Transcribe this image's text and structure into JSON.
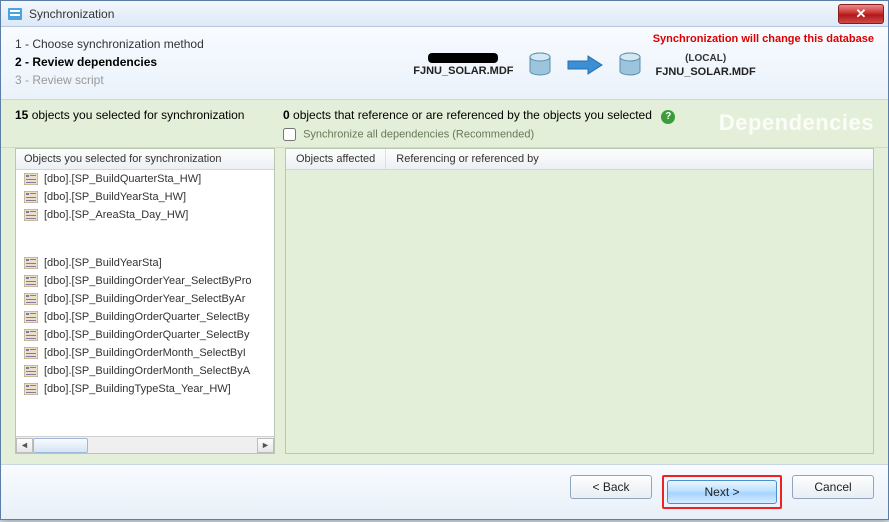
{
  "window": {
    "title": "Synchronization"
  },
  "titlebar": {
    "close_glyph": "✕"
  },
  "steps": {
    "s1": "1 - Choose synchronization method",
    "s2": "2 - Review dependencies",
    "s3": "3 - Review script"
  },
  "header_warning": "Synchronization will change this database",
  "source_db": "FJNU_SOLAR.MDF",
  "target_db_local": "(LOCAL)",
  "target_db": "FJNU_SOLAR.MDF",
  "counts": {
    "left_num": "15",
    "left_text": " objects you selected for synchronization",
    "right_num": "0",
    "right_text": " objects that reference or are referenced by the objects you selected",
    "help": "?",
    "sync_all": "Synchronize all dependencies (Recommended)"
  },
  "dep_bg_label": "Dependencies",
  "left_list": {
    "header": "Objects you selected for synchronization",
    "items": [
      "[dbo].[SP_BuildQuarterSta_HW]",
      "[dbo].[SP_BuildYearSta_HW]",
      "[dbo].[SP_AreaSta_Day_HW]",
      "",
      "[dbo].[SP_BuildYearSta]",
      "[dbo].[SP_BuildingOrderYear_SelectByPro",
      "[dbo].[SP_BuildingOrderYear_SelectByAr",
      "[dbo].[SP_BuildingOrderQuarter_SelectBy",
      "[dbo].[SP_BuildingOrderQuarter_SelectBy",
      "[dbo].[SP_BuildingOrderMonth_SelectByI",
      "[dbo].[SP_BuildingOrderMonth_SelectByA",
      "[dbo].[SP_BuildingTypeSta_Year_HW]"
    ]
  },
  "right_panel": {
    "col1": "Objects affected",
    "col2": "Referencing or referenced by"
  },
  "footer": {
    "back": "< Back",
    "next": "Next >",
    "cancel": "Cancel"
  }
}
